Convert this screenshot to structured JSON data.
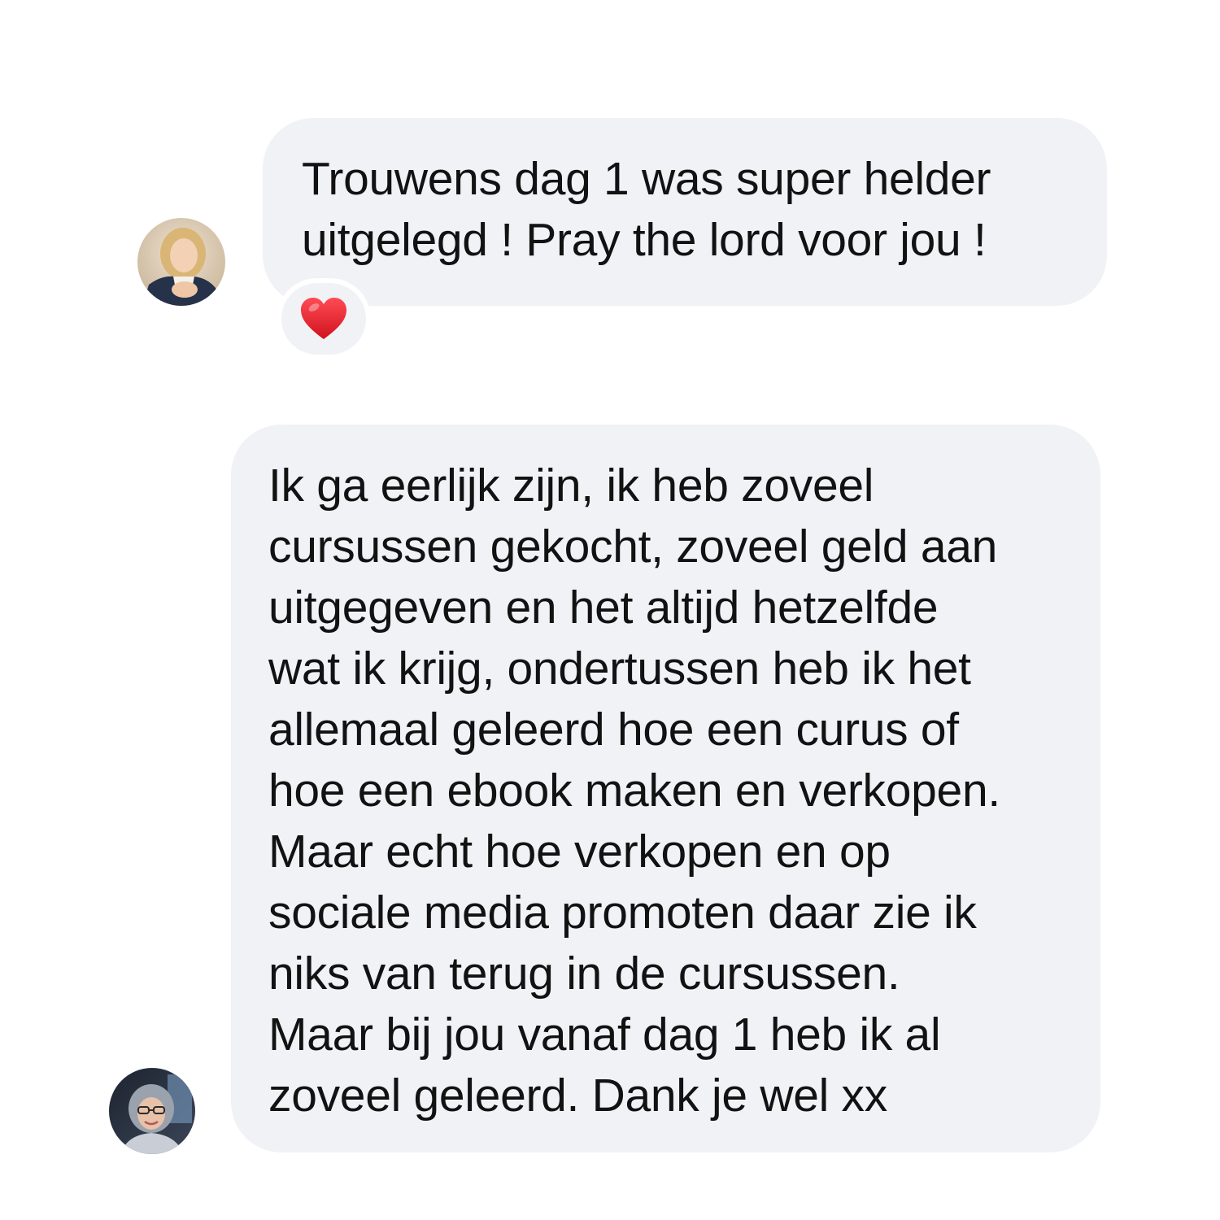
{
  "conversation": {
    "messages": [
      {
        "sender_avatar": "avatar-blonde-woman",
        "lines": [
          "Trouwens dag 1 was super helder",
          "uitgelegd ! Pray the lord voor jou !"
        ],
        "reaction": "heart-icon"
      },
      {
        "sender_avatar": "avatar-woman-headscarf-glasses",
        "lines": [
          "Ik ga eerlijk zijn, ik heb zoveel",
          "cursussen gekocht, zoveel geld aan",
          "uitgegeven en het altijd hetzelfde",
          "wat ik krijg, ondertussen heb ik het",
          "allemaal geleerd hoe een curus of",
          "hoe een ebook maken en verkopen.",
          "Maar echt hoe verkopen en op",
          "sociale media promoten daar zie ik",
          "niks van terug in de cursussen.",
          "Maar bij jou vanaf dag 1 heb ik al",
          "zoveel geleerd. Dank je wel xx"
        ]
      }
    ]
  },
  "colors": {
    "background": "#ffffff",
    "bubble": "#f1f2f6",
    "text": "#121212",
    "heart": "#e0242d"
  }
}
